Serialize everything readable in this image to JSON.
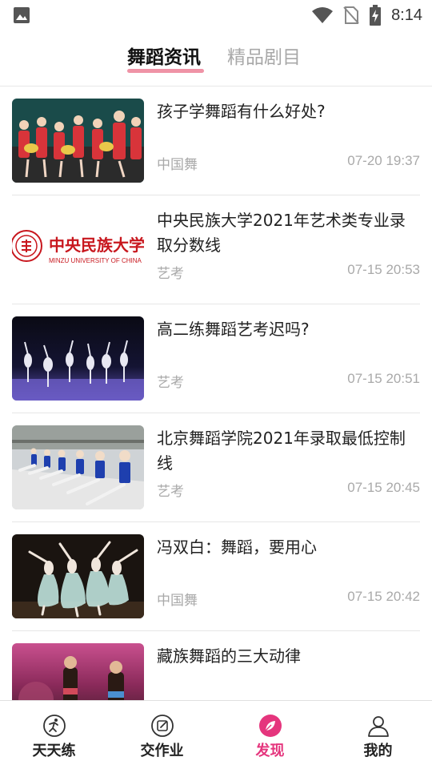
{
  "status_bar": {
    "time": "8:14",
    "left_icon": "image-notification-icon",
    "right_icons": [
      "wifi-icon",
      "no-sim-icon",
      "battery-charging-icon"
    ]
  },
  "tabs": [
    {
      "label": "舞蹈资讯",
      "active": true
    },
    {
      "label": "精品剧目",
      "active": false
    }
  ],
  "articles": [
    {
      "title": "孩子学舞蹈有什么好处?",
      "category": "中国舞",
      "time": "07-20 19:37",
      "thumb": "dance-group-photo"
    },
    {
      "title": "中央民族大学2021年艺术类专业录取分数线",
      "category": "艺考",
      "time": "07-15 20:53",
      "thumb": "minzu-university-logo"
    },
    {
      "title": "高二练舞蹈艺考迟吗?",
      "category": "艺考",
      "time": "07-15 20:51",
      "thumb": "stage-ballet-photo"
    },
    {
      "title": "北京舞蹈学院2021年录取最低控制线",
      "category": "艺考",
      "time": "07-15 20:45",
      "thumb": "dance-class-photo"
    },
    {
      "title": "冯双白：舞蹈，要用心",
      "category": "中国舞",
      "time": "07-15 20:42",
      "thumb": "ballet-performance-photo"
    },
    {
      "title": "藏族舞蹈的三大动律",
      "category": "",
      "time": "",
      "thumb": "tibetan-dance-photo"
    }
  ],
  "thumb_text": {
    "logo_cn": "中央民族大学",
    "logo_en": "MINZU UNIVERSITY OF CHINA"
  },
  "bottom_nav": [
    {
      "label": "天天练",
      "icon": "practice-icon",
      "active": false
    },
    {
      "label": "交作业",
      "icon": "submit-homework-icon",
      "active": false
    },
    {
      "label": "发现",
      "icon": "discover-icon",
      "active": true
    },
    {
      "label": "我的",
      "icon": "profile-icon",
      "active": false
    }
  ],
  "colors": {
    "accent": "#e5357d",
    "tab_underline": "#ef93a6",
    "logo_red": "#c8171e"
  }
}
